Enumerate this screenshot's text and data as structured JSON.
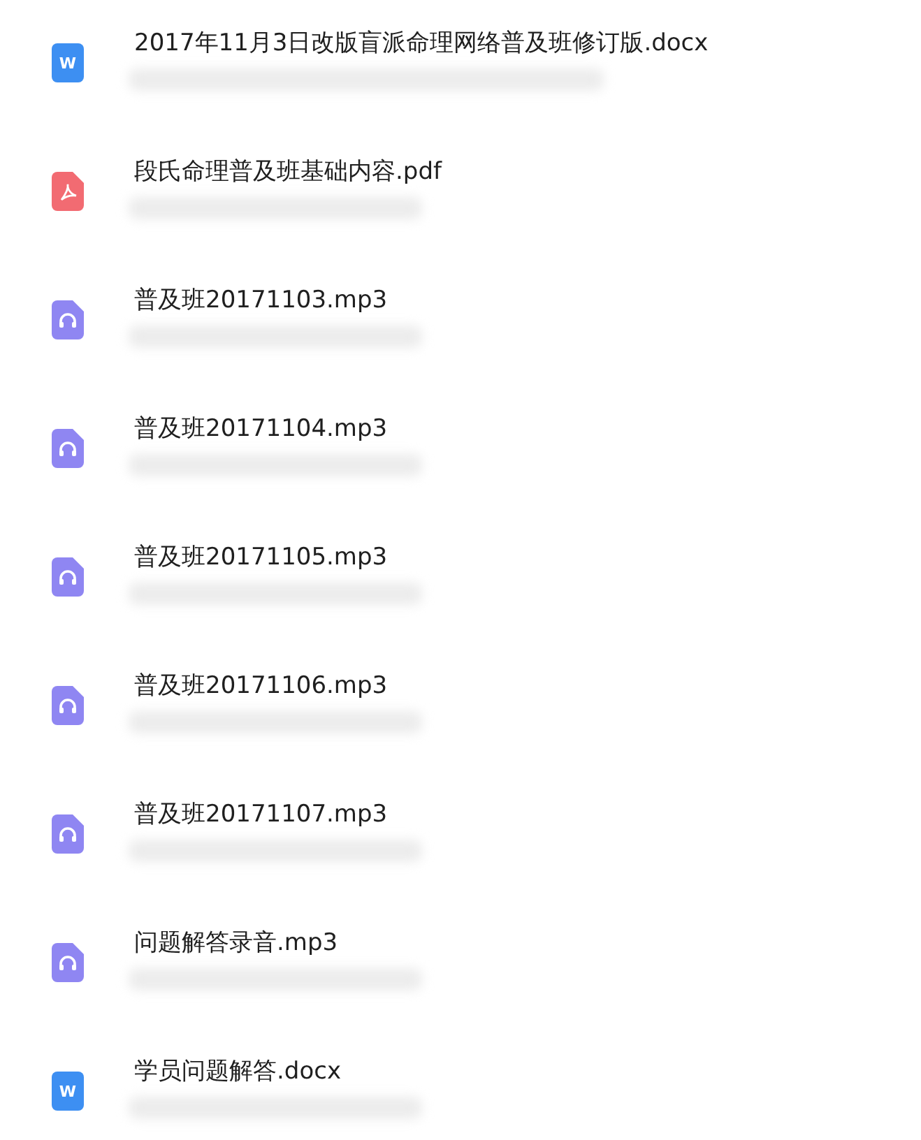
{
  "files": [
    {
      "kind": "docx",
      "badge": "W",
      "name": "2017年11月3日改版盲派命理网络普及班修订版.docx"
    },
    {
      "kind": "pdf",
      "name": "段氏命理普及班基础内容.pdf"
    },
    {
      "kind": "audio",
      "name": "普及班20171103.mp3"
    },
    {
      "kind": "audio",
      "name": "普及班20171104.mp3"
    },
    {
      "kind": "audio",
      "name": "普及班20171105.mp3"
    },
    {
      "kind": "audio",
      "name": "普及班20171106.mp3"
    },
    {
      "kind": "audio",
      "name": "普及班20171107.mp3"
    },
    {
      "kind": "audio",
      "name": "问题解答录音.mp3"
    },
    {
      "kind": "docx",
      "badge": "W",
      "name": "学员问题解答.docx"
    }
  ]
}
